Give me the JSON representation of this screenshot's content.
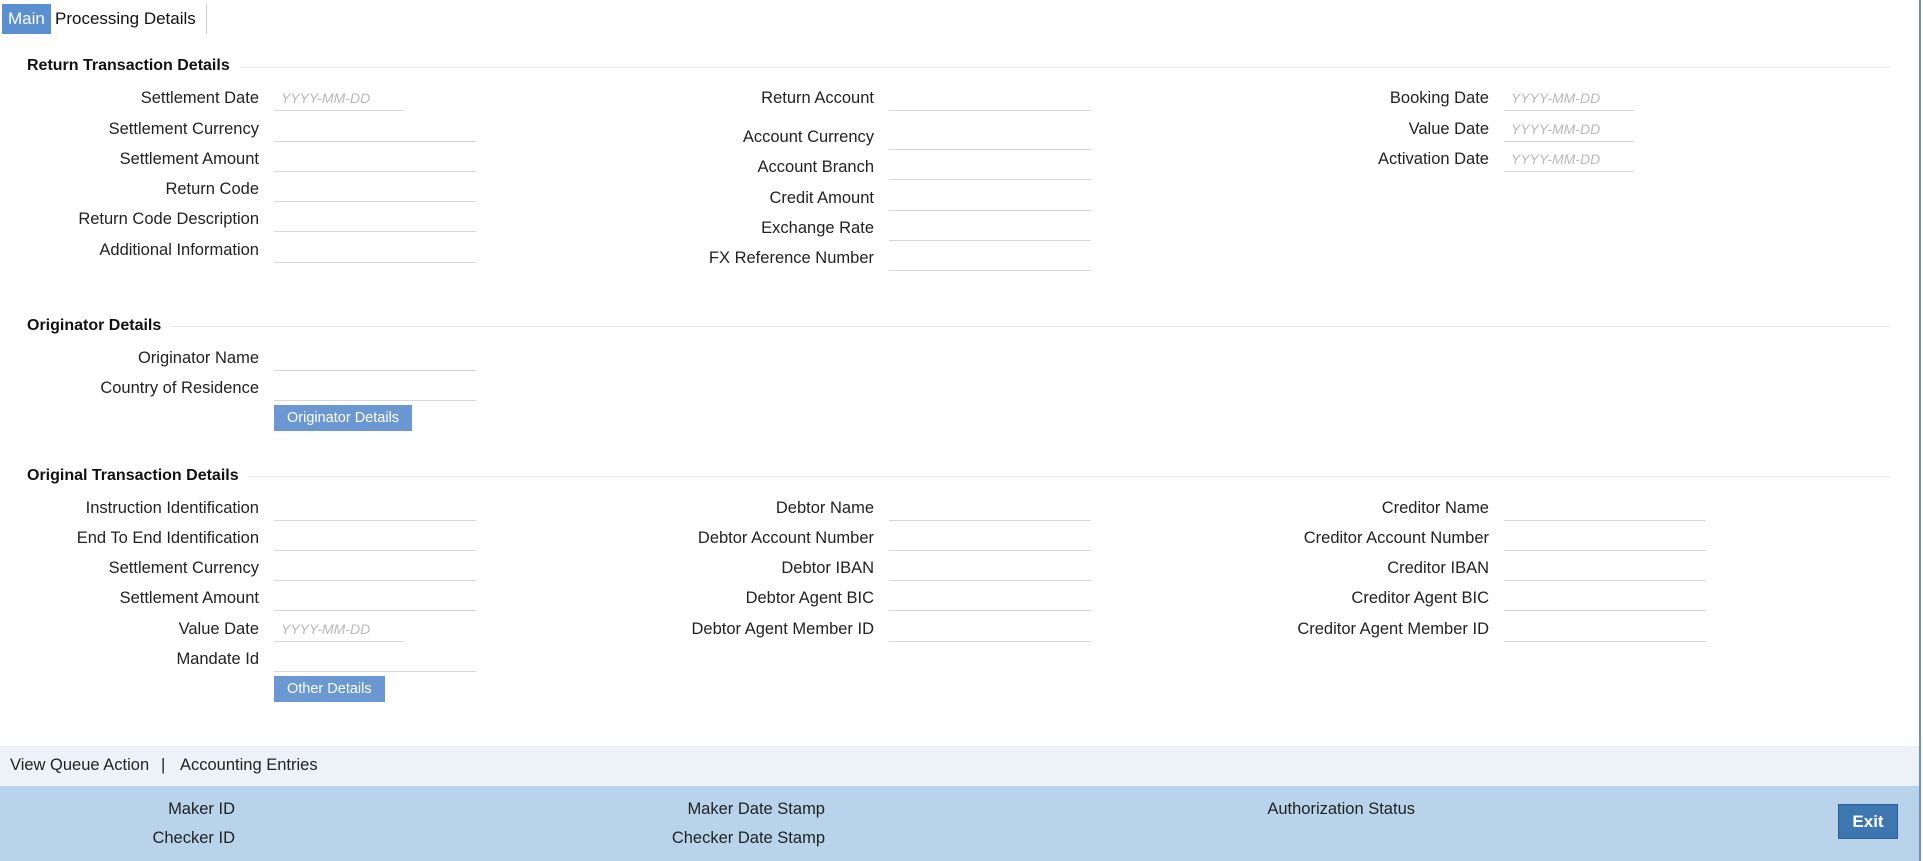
{
  "tabs": {
    "main": "Main",
    "processing": "Processing Details"
  },
  "return_txn": {
    "title": "Return Transaction Details",
    "settlement_date": "Settlement Date",
    "settlement_currency": "Settlement Currency",
    "settlement_amount": "Settlement Amount",
    "return_code": "Return Code",
    "return_code_description": "Return Code Description",
    "additional_information": "Additional Information",
    "return_account": "Return Account",
    "account_currency": "Account Currency",
    "account_branch": "Account Branch",
    "credit_amount": "Credit Amount",
    "exchange_rate": "Exchange Rate",
    "fx_reference_number": "FX Reference Number",
    "booking_date": "Booking Date",
    "value_date": "Value Date",
    "activation_date": "Activation Date"
  },
  "date_placeholder": "YYYY-MM-DD",
  "originator": {
    "title": "Originator Details",
    "name": "Originator Name",
    "country": "Country of Residence",
    "button": "Originator Details"
  },
  "original_txn": {
    "title": "Original Transaction Details",
    "instruction_id": "Instruction Identification",
    "end_to_end_id": "End To End Identification",
    "settlement_currency": "Settlement Currency",
    "settlement_amount": "Settlement Amount",
    "value_date": "Value Date",
    "mandate_id": "Mandate Id",
    "debtor_name": "Debtor Name",
    "debtor_account_number": "Debtor Account Number",
    "debtor_iban": "Debtor IBAN",
    "debtor_agent_bic": "Debtor Agent BIC",
    "debtor_agent_member_id": "Debtor Agent Member ID",
    "creditor_name": "Creditor Name",
    "creditor_account_number": "Creditor Account Number",
    "creditor_iban": "Creditor IBAN",
    "creditor_agent_bic": "Creditor Agent BIC",
    "creditor_agent_member_id": "Creditor Agent Member ID",
    "button": "Other Details"
  },
  "links": {
    "view_queue_action": "View Queue Action",
    "separator": "|",
    "accounting_entries": "Accounting Entries"
  },
  "audit": {
    "maker_id": "Maker ID",
    "checker_id": "Checker ID",
    "maker_date_stamp": "Maker Date Stamp",
    "checker_date_stamp": "Checker Date Stamp",
    "authorization_status": "Authorization Status",
    "exit": "Exit"
  }
}
